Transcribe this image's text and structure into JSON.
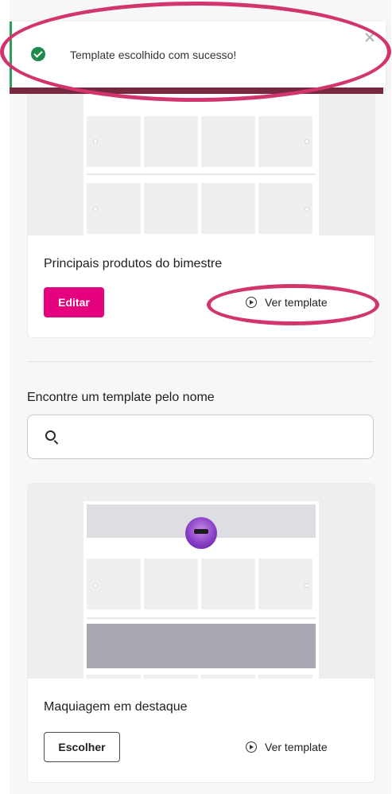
{
  "toast": {
    "message": "Template escolhido com sucesso!",
    "status_color": "#1f8a4c"
  },
  "cards": [
    {
      "title": "Principais produtos do bimestre",
      "primary_button": "Editar",
      "view_link": "Ver template"
    },
    {
      "title": "Maquiagem em destaque",
      "primary_button": "Escolher",
      "view_link": "Ver template"
    }
  ],
  "search": {
    "label": "Encontre um template pelo nome",
    "value": "",
    "placeholder": ""
  },
  "icons": {
    "toast": "check-circle-icon",
    "close": "close-icon",
    "view": "play-circle-icon",
    "search": "search-icon"
  },
  "colors": {
    "accent": "#e5007e",
    "annotation": "#d2346e"
  }
}
